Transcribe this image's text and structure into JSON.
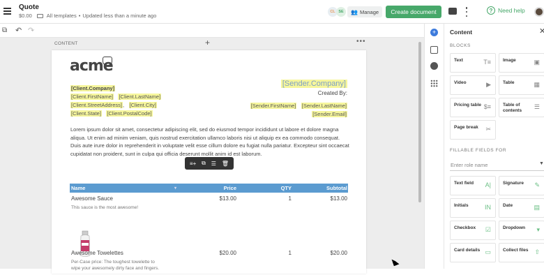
{
  "app": {
    "title": "Quote",
    "price": "$0.00",
    "breadcrumb": "All templates",
    "status": "Updated less than a minute ago"
  },
  "header": {
    "avatars": [
      {
        "initials": "CL",
        "bg": "#e8eef2",
        "fg": "#e69a5c"
      },
      {
        "initials": "SE",
        "bg": "#dff0e3",
        "fg": "#47a86a"
      }
    ],
    "manage_label": "Manage",
    "create_label": "Create document",
    "help_label": "Need help",
    "accent": "#47a86a"
  },
  "editor": {
    "content_label": "CONTENT"
  },
  "document": {
    "logo": "acme",
    "client_fields": [
      [
        "[Client.Company]"
      ],
      [
        "[Client.FirstName]",
        "[Client.LastName]"
      ],
      [
        "[Client.StreetAddress]",
        ",",
        "[Client.City]"
      ],
      [
        "[Client.State]",
        "[Client.PostalCode]"
      ]
    ],
    "sender_company": "[Sender.Company]",
    "created_by": "Created By:",
    "sender_fields": [
      [
        "[Sender.FirstName]",
        "[Sender.LastName]"
      ],
      [
        "[Sender.Email]"
      ]
    ],
    "body": "Lorem ipsum dolor sit amet, consectetur adipiscing elit, sed do eiusmod tempor incididunt ut labore et dolore magna aliqua. Ut enim ad minim veniam, quis nostrud exercitation ullamco laboris nisi ut aliquip ex ea commodo consequat. Duis aute irure dolor in reprehenderit in voluptate velit esse cillum dolore eu fugiat nulla pariatur. Excepteur sint occaecat cupidatat non proident, sunt in culpa qui officia deserunt mollit anim id est laborum.",
    "table": {
      "headers": [
        "Name",
        "Price",
        "QTY",
        "Subtotal"
      ],
      "rows": [
        {
          "name": "Awesome Sauce",
          "desc": "This sauce is the most awesome!",
          "price": "$13.00",
          "qty": "1",
          "subtotal": "$13.00"
        },
        {
          "name": "Awesome Towelettes",
          "desc": "Per-Case price: The toughest towelette to wipe your awesomely dirty face and fingers.",
          "price": "$20.00",
          "qty": "1",
          "subtotal": "$20.00"
        }
      ]
    }
  },
  "panel": {
    "title": "Content",
    "blocks_label": "BLOCKS",
    "blocks": [
      {
        "label": "Text",
        "icon": "text-icon"
      },
      {
        "label": "Image",
        "icon": "image-icon"
      },
      {
        "label": "Video",
        "icon": "video-icon"
      },
      {
        "label": "Table",
        "icon": "table-icon"
      },
      {
        "label": "Pricing table",
        "icon": "pricing-icon"
      },
      {
        "label": "Table of contents",
        "icon": "toc-icon"
      },
      {
        "label": "Page break",
        "icon": "page-break-icon"
      }
    ],
    "fillable_label": "FILLABLE FIELDS FOR",
    "role_placeholder": "Enter role name",
    "fields": [
      {
        "label": "Text field",
        "icon": "text-field-icon"
      },
      {
        "label": "Signature",
        "icon": "signature-icon"
      },
      {
        "label": "Initials",
        "icon": "initials-icon"
      },
      {
        "label": "Date",
        "icon": "calendar-icon"
      },
      {
        "label": "Checkbox",
        "icon": "checkbox-icon"
      },
      {
        "label": "Dropdown",
        "icon": "dropdown-icon"
      },
      {
        "label": "Card details",
        "icon": "card-icon"
      },
      {
        "label": "Collect files",
        "icon": "upload-icon"
      }
    ]
  }
}
